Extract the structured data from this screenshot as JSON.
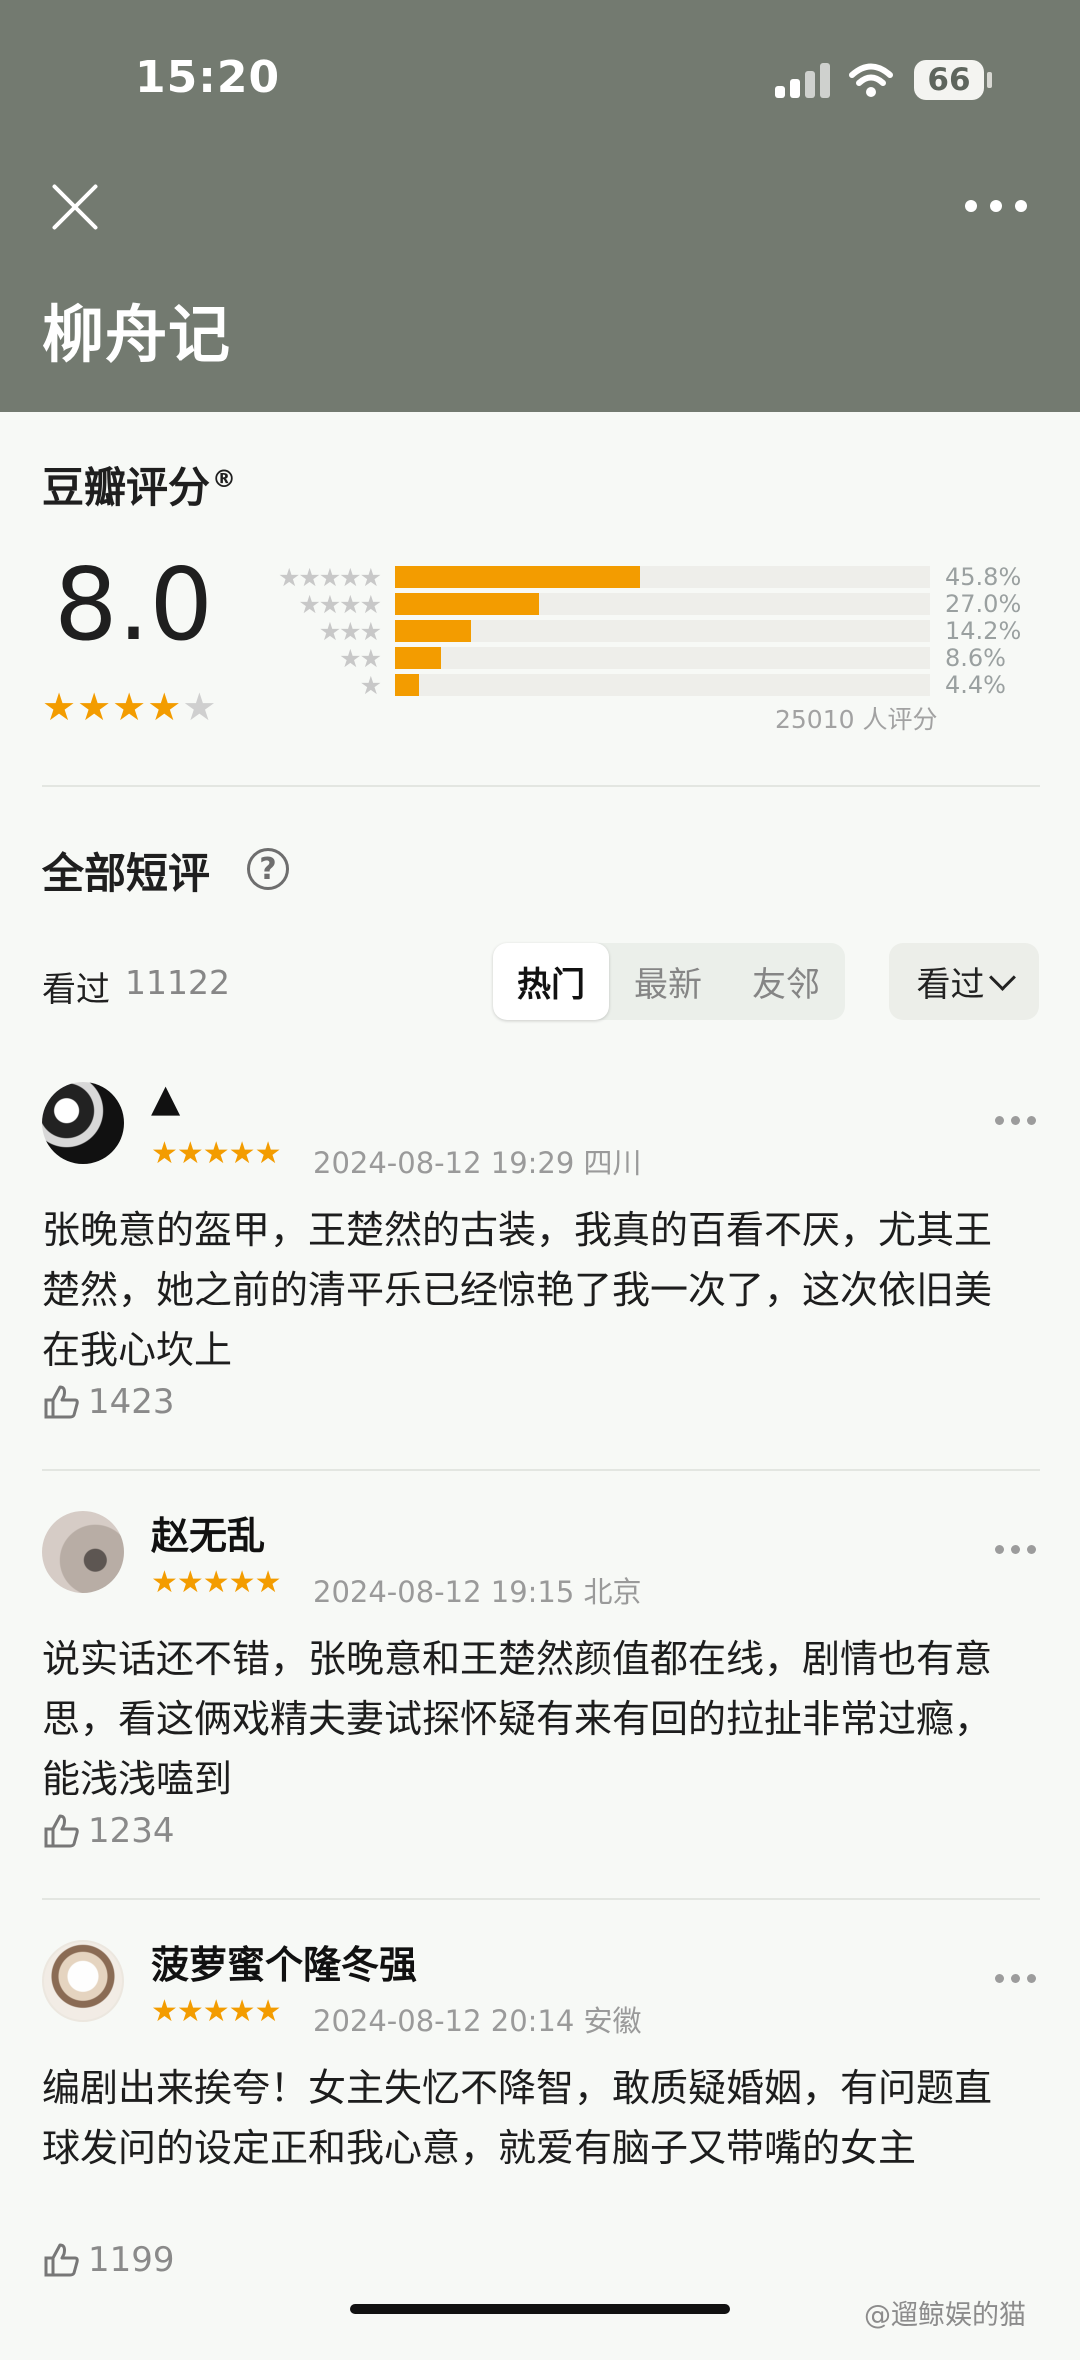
{
  "status_bar": {
    "time": "15:20",
    "battery": "66"
  },
  "header": {
    "title": "柳舟记"
  },
  "rating": {
    "heading": "豆瓣评分",
    "registered": "®",
    "score": "8.0",
    "stars": 4,
    "distribution": [
      {
        "stars": 5,
        "percent": 45.8,
        "label": "45.8%"
      },
      {
        "stars": 4,
        "percent": 27.0,
        "label": "27.0%"
      },
      {
        "stars": 3,
        "percent": 14.2,
        "label": "14.2%"
      },
      {
        "stars": 2,
        "percent": 8.6,
        "label": "8.6%"
      },
      {
        "stars": 1,
        "percent": 4.4,
        "label": "4.4%"
      }
    ],
    "count_label": "25010 人评分"
  },
  "short_reviews": {
    "title": "全部短评",
    "seen_label": "看过",
    "seen_count": "11122",
    "tabs": [
      "热门",
      "最新",
      "友邻"
    ],
    "active_tab": "热门",
    "filter": "看过"
  },
  "reviews": [
    {
      "name": "▲",
      "stars": 5,
      "meta": "2024-08-12 19:29 四川",
      "text": "张晚意的盔甲，王楚然的古装，我真的百看不厌，尤其王楚然，她之前的清平乐已经惊艳了我一次了，这次依旧美在我心坎上",
      "likes": "1423"
    },
    {
      "name": "赵无乱",
      "stars": 5,
      "meta": "2024-08-12 19:15 北京",
      "text": "说实话还不错，张晚意和王楚然颜值都在线，剧情也有意思，看这俩戏精夫妻试探怀疑有来有回的拉扯非常过瘾，能浅浅嗑到",
      "likes": "1234"
    },
    {
      "name": "菠萝蜜个隆冬强",
      "stars": 5,
      "meta": "2024-08-12 20:14 安徽",
      "text": "编剧出来挨夸！女主失忆不降智，敢质疑婚姻，有问题直球发问的设定正和我心意，就爱有脑子又带嘴的女主",
      "likes": "1199"
    }
  ],
  "watermark": "@遛鲸娱的猫"
}
